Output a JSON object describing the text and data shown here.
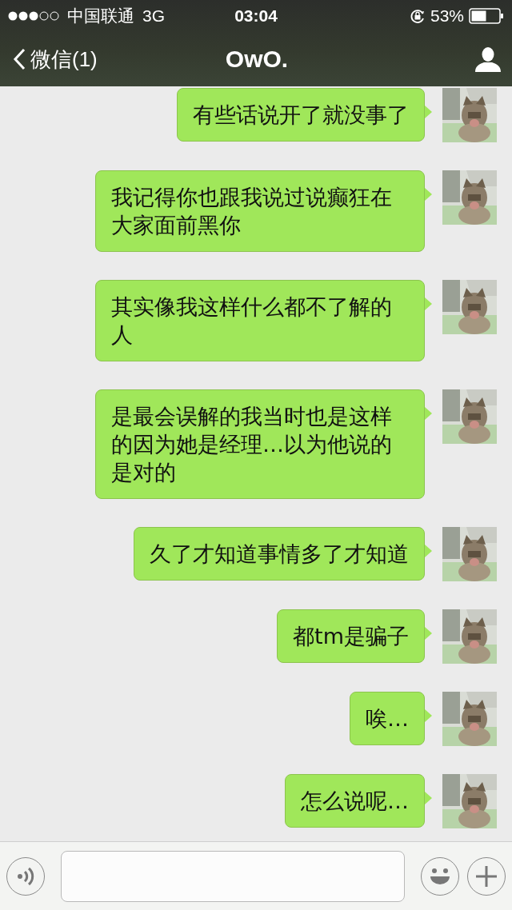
{
  "status_bar": {
    "carrier": "中国联通",
    "network": "3G",
    "time": "03:04",
    "battery_percent": "53%"
  },
  "nav_bar": {
    "back_label": "微信(1)",
    "title": "OwO."
  },
  "messages": [
    {
      "text": "有些话说开了就没事了"
    },
    {
      "text": "我记得你也跟我说过说癫狂在大家面前黑你"
    },
    {
      "text": "其实像我这样什么都不了解的人"
    },
    {
      "text": "是最会误解的我当时也是这样的因为她是经理…以为他说的是对的"
    },
    {
      "text": "久了才知道事情多了才知道"
    },
    {
      "text": "都tm是骗子"
    },
    {
      "text": "唉…"
    },
    {
      "text": "怎么说呢…"
    }
  ]
}
